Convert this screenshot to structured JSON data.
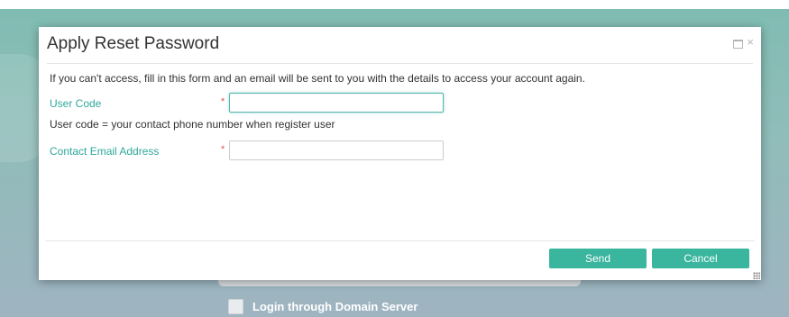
{
  "background": {
    "domain_login_label": "Login through Domain Server",
    "domain_login_checked": false
  },
  "dialog": {
    "title": "Apply Reset Password",
    "intro": "If you can't access, fill in this form and an email will be sent to you with the details to access your account again.",
    "fields": [
      {
        "label": "User Code",
        "required_mark": "*",
        "value": "",
        "placeholder": ""
      },
      {
        "label": "Contact Email Address",
        "required_mark": "*",
        "value": "",
        "placeholder": ""
      }
    ],
    "hint": "User code = your contact phone number when register user",
    "close_glyph": "×",
    "send_label": "Send",
    "cancel_label": "Cancel"
  },
  "icons": {
    "maximize": "maximize-icon",
    "close": "close-icon",
    "resize": "resize-grip-icon"
  },
  "colors": {
    "accent": "#3ab59e",
    "label": "#2fa89c",
    "required": "#e05a4a"
  }
}
